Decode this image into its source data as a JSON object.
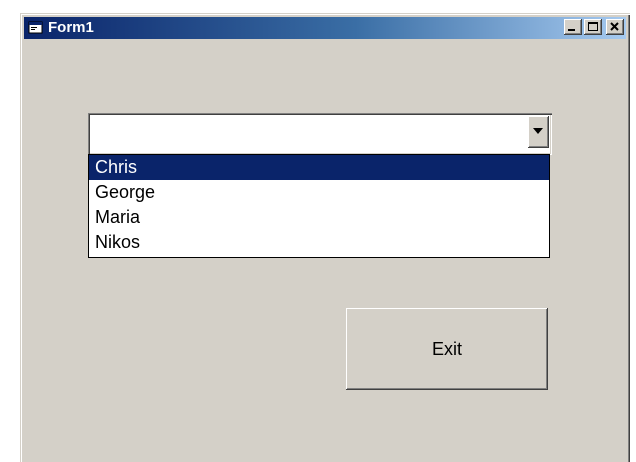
{
  "window": {
    "title": "Form1",
    "minimize_icon": "minimize-icon",
    "maximize_icon": "maximize-icon",
    "close_icon": "close-icon",
    "app_icon": "form-app-icon"
  },
  "combo": {
    "value": "",
    "dropdown_icon": "chevron-down-icon",
    "items": [
      "Chris",
      "George",
      "Maria",
      "Nikos"
    ],
    "selected_index": 0
  },
  "exit_button": {
    "label": "Exit"
  },
  "colors": {
    "titlebar_start": "#0a246a",
    "titlebar_end": "#a6caf0",
    "face": "#d4d0c8",
    "selection": "#0a246a"
  }
}
